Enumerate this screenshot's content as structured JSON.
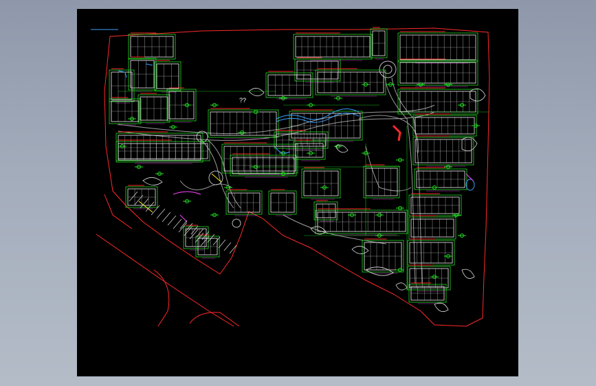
{
  "viewer": {
    "background_color": "#000000",
    "frame_color": "#9aa3b3"
  },
  "drawing": {
    "subject": "site-plan",
    "label_marker": "??",
    "layer_colors": {
      "boundary": "#ff2a2a",
      "buildings": "#f2f2f2",
      "roads": "#9a9a9a",
      "landscape": "#22dd22",
      "water": "#3aa0ff",
      "magenta": "#ff44ff",
      "yellow": "#ffee22"
    }
  }
}
